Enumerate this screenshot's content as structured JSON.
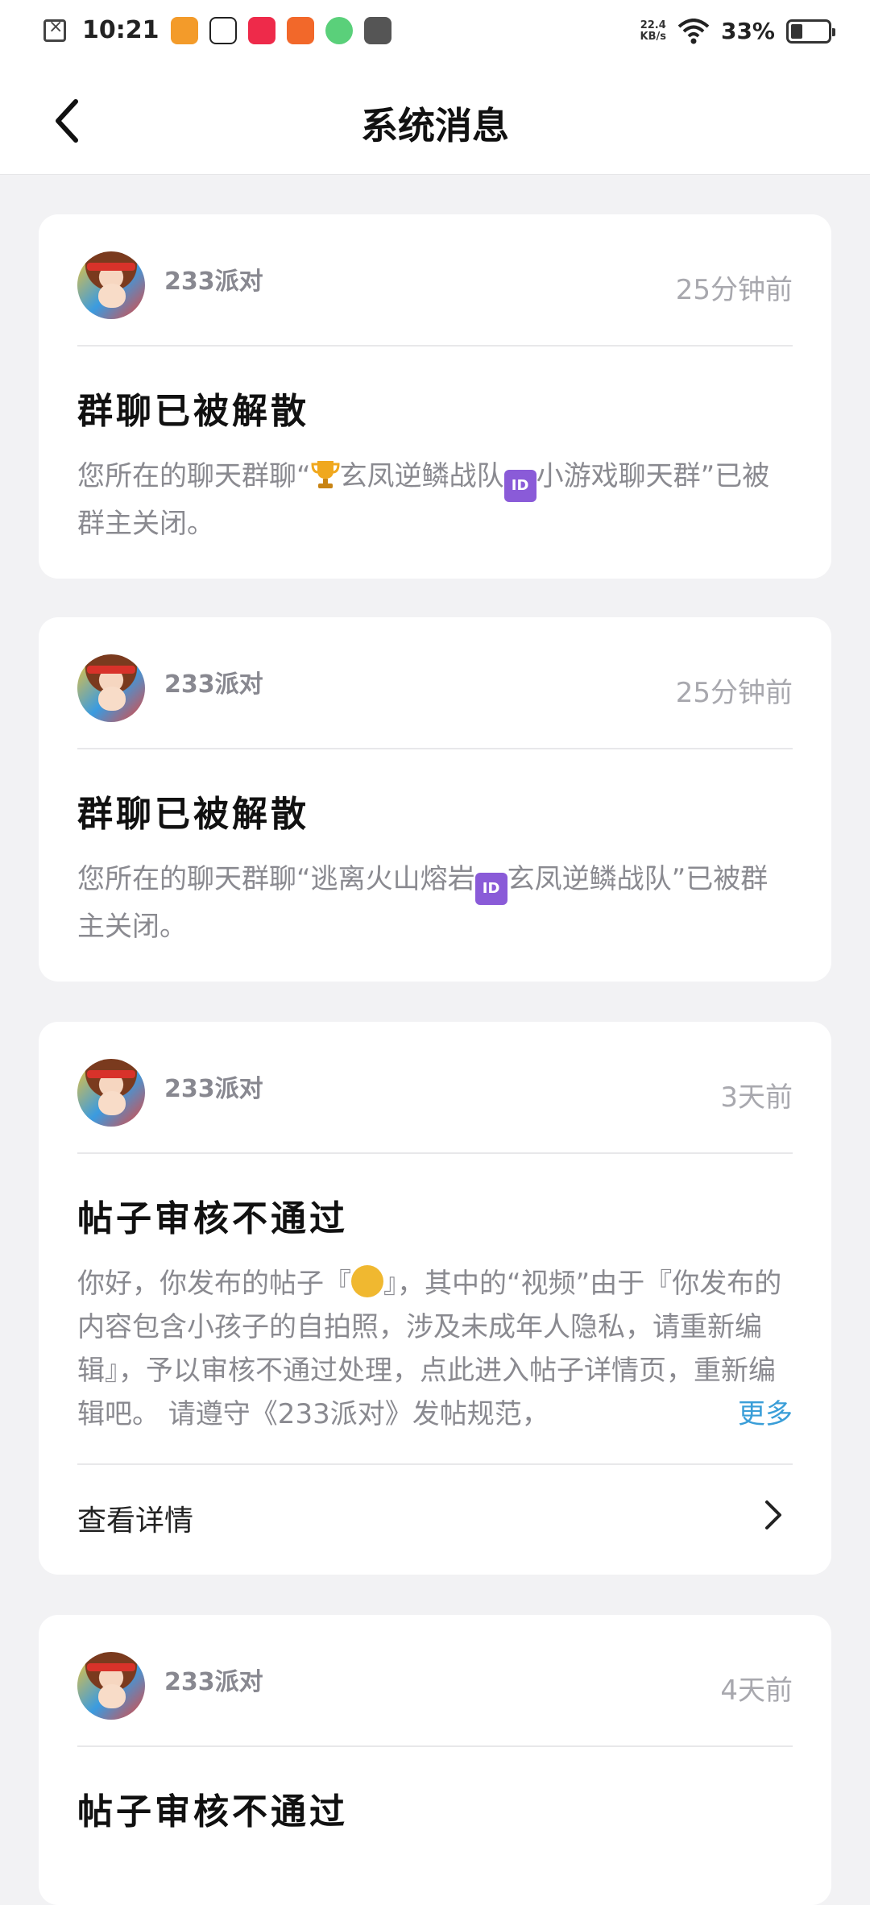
{
  "status_bar": {
    "time": "10:21",
    "speed": "22.4",
    "speed_unit": "KB/s",
    "battery": "33%",
    "app_icons": [
      "video-app",
      "tiktok",
      "xiaohongshu",
      "taobao",
      "app-green",
      "vivo"
    ]
  },
  "header": {
    "title": "系统消息"
  },
  "messages": [
    {
      "sender": "233派对",
      "time": "25分钟前",
      "title": "群聊已被解散",
      "body_pre": "您所在的聊天群聊“",
      "body_mid": "玄凤逆鳞战队",
      "body_post": "小游戏聊天群”已被群主关闭。"
    },
    {
      "sender": "233派对",
      "time": "25分钟前",
      "title": "群聊已被解散",
      "body_pre": "您所在的聊天群聊“逃离火山熔岩",
      "body_post": "玄凤逆鳞战队”已被群主关闭。"
    },
    {
      "sender": "233派对",
      "time": "3天前",
      "title": "帖子审核不通过",
      "body_pre": "你好，你发布的帖子『",
      "body_post": "』，其中的“视频”由于『你发布的内容包含小孩子的自拍照，涉及未成年人隐私，请重新编辑』，予以审核不通过处理，点此进入帖子详情页，重新编辑吧。 请遵守《233派对》发帖规范，",
      "more": "更多",
      "detail": "查看详情"
    },
    {
      "sender": "233派对",
      "time": "4天前",
      "title": "帖子审核不通过"
    }
  ],
  "colors": {
    "background": "#f2f2f4",
    "card": "#ffffff",
    "link": "#3a9ed8",
    "muted": "#8a8a90"
  },
  "icons": {
    "back": "chevron-left-icon",
    "detail": "chevron-right-icon",
    "badge": "id-badge-icon",
    "trophy": "trophy-icon",
    "sad": "sad-face-icon"
  }
}
